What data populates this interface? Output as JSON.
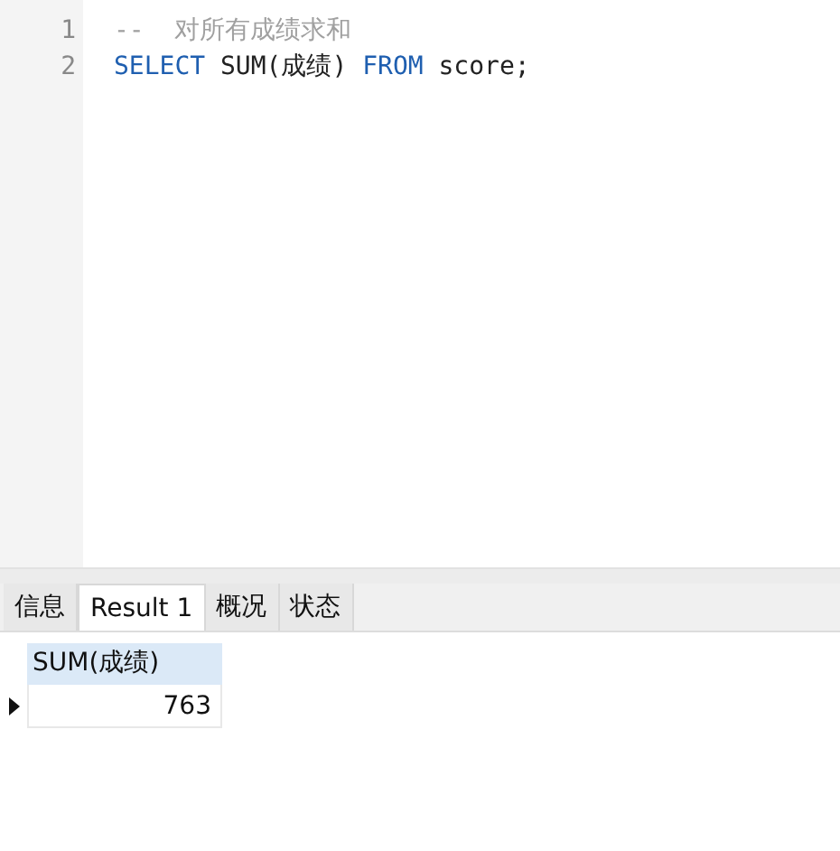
{
  "editor": {
    "lines": [
      {
        "number": "1",
        "tokens": [
          {
            "kind": "comment",
            "text": "--  对所有成绩求和"
          }
        ]
      },
      {
        "number": "2",
        "tokens": [
          {
            "kind": "keyword",
            "text": "SELECT"
          },
          {
            "kind": "plain",
            "text": " SUM(成绩) "
          },
          {
            "kind": "keyword",
            "text": "FROM"
          },
          {
            "kind": "plain",
            "text": " score;"
          }
        ]
      }
    ]
  },
  "tabs": [
    {
      "label": "信息",
      "selected": false
    },
    {
      "label": "Result 1",
      "selected": true
    },
    {
      "label": "概况",
      "selected": false
    },
    {
      "label": "状态",
      "selected": false
    }
  ],
  "grid": {
    "columns": [
      "SUM(成绩)"
    ],
    "rows": [
      {
        "current": true,
        "cells": [
          "763"
        ]
      }
    ]
  }
}
